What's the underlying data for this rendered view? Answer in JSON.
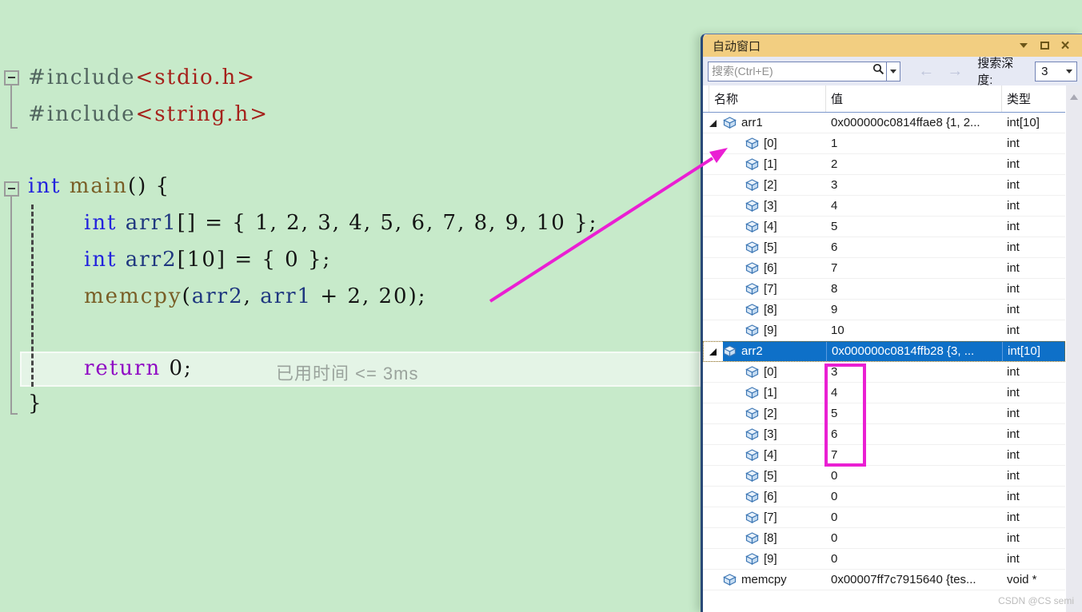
{
  "editor": {
    "lines": [
      [
        {
          "t": "#include",
          "c": "pp"
        },
        {
          "t": "<stdio.h>",
          "c": "str"
        }
      ],
      [
        {
          "t": "#include",
          "c": "pp"
        },
        {
          "t": "<string.h>",
          "c": "str"
        }
      ],
      [
        {
          "t": "int",
          "c": "kw"
        },
        {
          "t": " ",
          "c": "pl"
        },
        {
          "t": "main",
          "c": "fn"
        },
        {
          "t": "() {",
          "c": "pl"
        }
      ],
      [
        {
          "t": "int",
          "c": "kw"
        },
        {
          "t": " ",
          "c": "pl"
        },
        {
          "t": "arr1",
          "c": "var"
        },
        {
          "t": "[] = { 1, 2, 3, 4, 5, 6, 7, 8, 9, 10 };",
          "c": "pl"
        }
      ],
      [
        {
          "t": "int",
          "c": "kw"
        },
        {
          "t": " ",
          "c": "pl"
        },
        {
          "t": "arr2",
          "c": "var"
        },
        {
          "t": "[10] = { 0 };",
          "c": "pl"
        }
      ],
      [
        {
          "t": "memcpy",
          "c": "fn"
        },
        {
          "t": "(",
          "c": "pl"
        },
        {
          "t": "arr2",
          "c": "var"
        },
        {
          "t": ", ",
          "c": "pl"
        },
        {
          "t": "arr1",
          "c": "var"
        },
        {
          "t": " + 2, 20);",
          "c": "pl"
        }
      ],
      [
        {
          "t": "return",
          "c": "ret"
        },
        {
          "t": " 0;",
          "c": "pl"
        }
      ],
      [
        {
          "t": "}",
          "c": "pl"
        }
      ]
    ],
    "perf_tip": "已用时间 <= 3ms"
  },
  "autos_window": {
    "title": "自动窗口",
    "search_placeholder": "搜索(Ctrl+E)",
    "nav_back": "←",
    "nav_forward": "→",
    "search_depth_label": "搜索深度:",
    "search_depth_value": "3",
    "columns": {
      "name": "名称",
      "value": "值",
      "type": "类型"
    },
    "rows": [
      {
        "name": "arr1",
        "value": "0x000000c0814ffae8 {1, 2...",
        "type": "int[10]",
        "level": 0,
        "expander": true,
        "selected": false
      },
      {
        "name": "[0]",
        "value": "1",
        "type": "int",
        "level": 1
      },
      {
        "name": "[1]",
        "value": "2",
        "type": "int",
        "level": 1
      },
      {
        "name": "[2]",
        "value": "3",
        "type": "int",
        "level": 1
      },
      {
        "name": "[3]",
        "value": "4",
        "type": "int",
        "level": 1
      },
      {
        "name": "[4]",
        "value": "5",
        "type": "int",
        "level": 1
      },
      {
        "name": "[5]",
        "value": "6",
        "type": "int",
        "level": 1
      },
      {
        "name": "[6]",
        "value": "7",
        "type": "int",
        "level": 1
      },
      {
        "name": "[7]",
        "value": "8",
        "type": "int",
        "level": 1
      },
      {
        "name": "[8]",
        "value": "9",
        "type": "int",
        "level": 1
      },
      {
        "name": "[9]",
        "value": "10",
        "type": "int",
        "level": 1
      },
      {
        "name": "arr2",
        "value": "0x000000c0814ffb28 {3, ...",
        "type": "int[10]",
        "level": 0,
        "expander": true,
        "selected": true
      },
      {
        "name": "[0]",
        "value": "3",
        "type": "int",
        "level": 1
      },
      {
        "name": "[1]",
        "value": "4",
        "type": "int",
        "level": 1
      },
      {
        "name": "[2]",
        "value": "5",
        "type": "int",
        "level": 1
      },
      {
        "name": "[3]",
        "value": "6",
        "type": "int",
        "level": 1
      },
      {
        "name": "[4]",
        "value": "7",
        "type": "int",
        "level": 1
      },
      {
        "name": "[5]",
        "value": "0",
        "type": "int",
        "level": 1
      },
      {
        "name": "[6]",
        "value": "0",
        "type": "int",
        "level": 1
      },
      {
        "name": "[7]",
        "value": "0",
        "type": "int",
        "level": 1
      },
      {
        "name": "[8]",
        "value": "0",
        "type": "int",
        "level": 1
      },
      {
        "name": "[9]",
        "value": "0",
        "type": "int",
        "level": 1
      },
      {
        "name": "memcpy",
        "value": "0x00007ff7c7915640 {tes...",
        "type": "void *",
        "level": 0,
        "expander": false,
        "selected": false
      }
    ]
  },
  "annotations": {
    "color": "#ea1fd3"
  },
  "watermark": "CSDN @CS semi"
}
